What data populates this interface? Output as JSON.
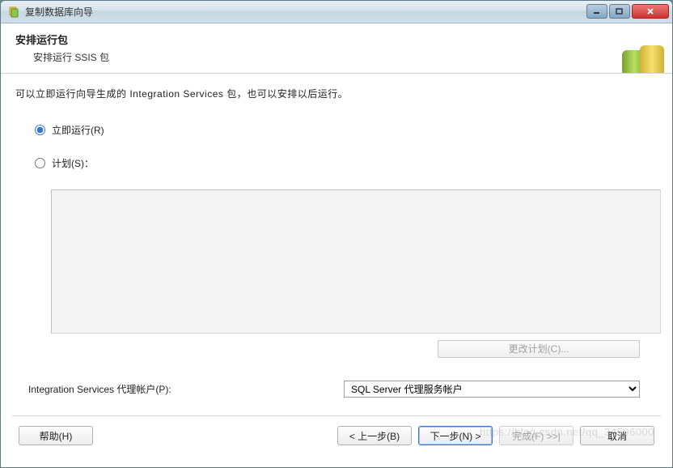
{
  "window": {
    "title": "复制数据库向导"
  },
  "header": {
    "title": "安排运行包",
    "subtitle": "安排运行 SSIS 包"
  },
  "intro": "可以立即运行向导生成的 Integration Services 包，也可以安排以后运行。",
  "options": {
    "run_now": "立即运行(R)",
    "schedule": "计划(S)："
  },
  "change_schedule": "更改计划(C)...",
  "proxy": {
    "label": "Integration Services 代理帐户(P):",
    "selected": "SQL Server 代理服务帐户"
  },
  "buttons": {
    "help": "帮助(H)",
    "back": "< 上一步(B)",
    "next": "下一步(N) >",
    "finish": "完成(F) >>|",
    "cancel": "取消"
  },
  "watermark": "https://blog.csdn.net/qq_34596000"
}
